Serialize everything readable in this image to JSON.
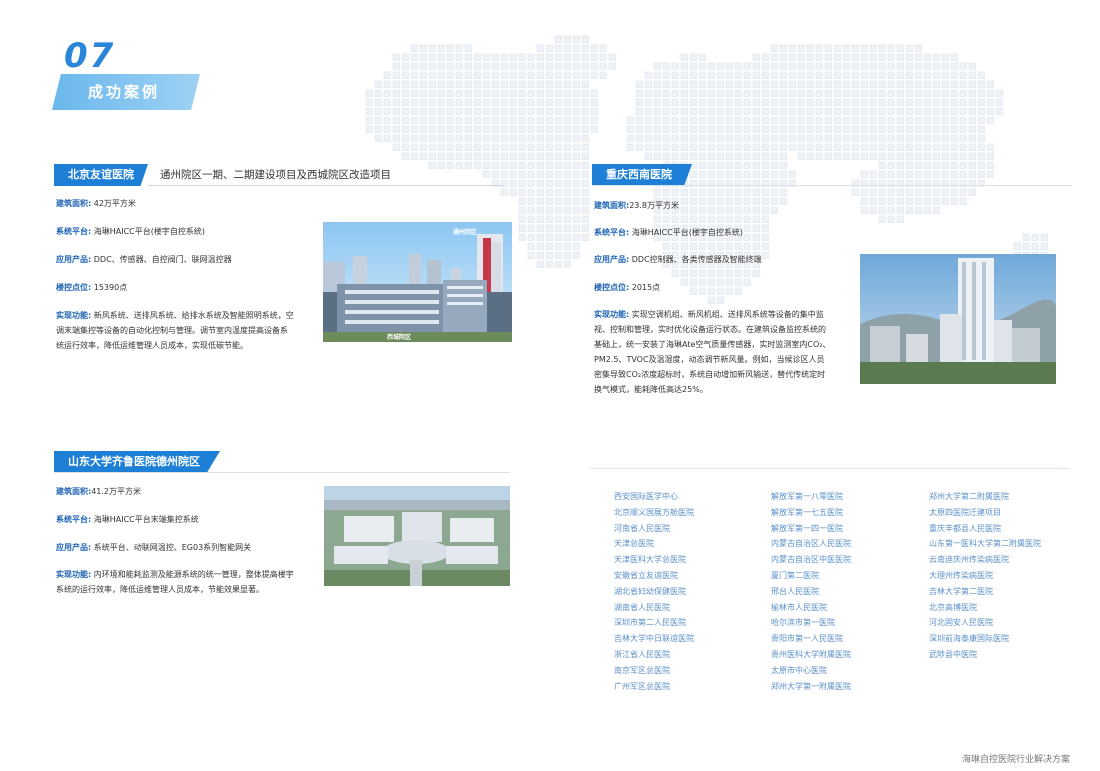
{
  "section": {
    "number": "07",
    "title": "成功案例"
  },
  "cases": [
    {
      "tag": "北京友谊医院",
      "subtitle": "通州院区一期、二期建设项目及西城院区改造项目",
      "fields": [
        {
          "key": "建筑面积:",
          "value": "42万平方米"
        },
        {
          "key": "系统平台:",
          "value": "海琳HAICC平台(楼宇自控系统)"
        },
        {
          "key": "应用产品:",
          "value": "DDC、传感器、自控阀门、联网温控器"
        },
        {
          "key": "楼控点位:",
          "value": "15390点"
        },
        {
          "key": "实现功能:",
          "value": "新风系统、送排风系统、给排水系统及智能照明系统，空调末端集控等设备的自动化控制与管理。调节室内温度提高设备系统运行效率，降低运维管理人员成本，实现低碳节能。"
        }
      ],
      "photo_captions": [
        "通州院区",
        "西城院区"
      ]
    },
    {
      "tag": "重庆西南医院",
      "subtitle": "",
      "fields": [
        {
          "key": "建筑面积:",
          "value": "23.8万平方米"
        },
        {
          "key": "系统平台:",
          "value": "海琳HAICC平台(楼宇自控系统)"
        },
        {
          "key": "应用产品:",
          "value": "DDC控制器、各类传感器及智能终端"
        },
        {
          "key": "楼控点位:",
          "value": "2015点"
        },
        {
          "key": "实现功能:",
          "value": "实现空调机组、新风机组、送排风系统等设备的集中监视、控制和管理，实时优化设备运行状态。在建筑设备监控系统的基础上，统一安装了海琳Ate空气质量传感器，实时监测室内CO₂、PM2.5、TVOC及温湿度，动态调节新风量。例如，当候诊区人员密集导致CO₂浓度超标时，系统自动增加新风输送，替代传统定时换气模式，能耗降低高达25%。"
        }
      ],
      "photo_captions": []
    },
    {
      "tag": "山东大学齐鲁医院德州院区",
      "subtitle": "",
      "fields": [
        {
          "key": "建筑面积:",
          "value": "41.2万平方米"
        },
        {
          "key": "系统平台:",
          "value": "海琳HAICC平台末端集控系统"
        },
        {
          "key": "应用产品:",
          "value": "系统平台、动联网温控、EG03系列智能网关"
        },
        {
          "key": "实现功能:",
          "value": "内环境和能耗监测及能源系统的统一管理，整体提高楼宇系统的运行效率，降低运维管理人员成本，节能效果显著。"
        }
      ],
      "photo_captions": []
    }
  ],
  "hospitals": {
    "col1": [
      "西安国际医学中心",
      "北京顺义国展方舱医院",
      "河南省人民医院",
      "天津总医院",
      "天津医科大学总医院",
      "安徽省立友谊医院",
      "湖北省妇幼保健医院",
      "湖南省人民医院",
      "深圳市第二人民医院",
      "吉林大学中日联谊医院",
      "浙江省人民医院",
      "南京军区总医院",
      "广州军区总医院"
    ],
    "col2": [
      "解放军第一八零医院",
      "解放军第一七五医院",
      "解放军第一四一医院",
      "内蒙古自治区人民医院",
      "内蒙古自治区中医医院",
      "厦门第二医院",
      "邢台人民医院",
      "榆林市人民医院",
      "哈尔滨市第一医院",
      "贵阳市第一人民医院",
      "贵州医科大学附属医院",
      "太原市中心医院",
      "郑州大学第一附属医院"
    ],
    "col3": [
      "郑州大学第二附属医院",
      "太原四医院迁建项目",
      "重庆丰都县人民医院",
      "山东第一医科大学第二附属医院",
      "云南迪庆州传染病医院",
      "大理州传染病医院",
      "吉林大学第二医院",
      "北京高博医院",
      "河北固安人民医院",
      "深圳前海泰康国际医院",
      "武陟县中医院"
    ]
  },
  "footer": "海琳自控医院行业解决方案"
}
